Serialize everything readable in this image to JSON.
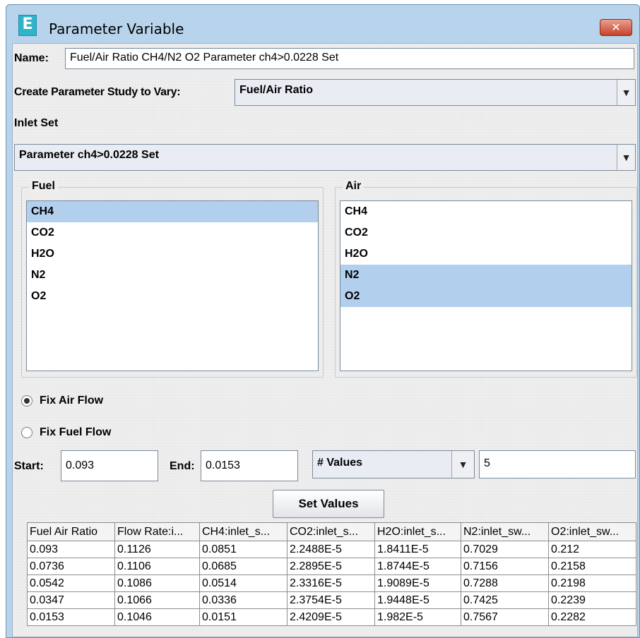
{
  "window": {
    "title": "Parameter Variable",
    "icon_letter": "E",
    "close_glyph": "✕"
  },
  "name_row": {
    "label": "Name:",
    "value": "Fuel/Air Ratio CH4/N2 O2 Parameter ch4>0.0228 Set"
  },
  "study": {
    "label": "Create Parameter Study to Vary:",
    "selected": "Fuel/Air Ratio"
  },
  "inlet": {
    "label": "Inlet Set",
    "selected": "Parameter ch4>0.0228 Set"
  },
  "fuel": {
    "title": "Fuel",
    "items": [
      {
        "label": "CH4",
        "selected": true
      },
      {
        "label": "CO2",
        "selected": false
      },
      {
        "label": "H2O",
        "selected": false
      },
      {
        "label": "N2",
        "selected": false
      },
      {
        "label": "O2",
        "selected": false
      }
    ]
  },
  "air": {
    "title": "Air",
    "items": [
      {
        "label": "CH4",
        "selected": false
      },
      {
        "label": "CO2",
        "selected": false
      },
      {
        "label": "H2O",
        "selected": false
      },
      {
        "label": "N2",
        "selected": true
      },
      {
        "label": "O2",
        "selected": true
      }
    ]
  },
  "flow_mode": {
    "options": [
      {
        "label": "Fix Air Flow",
        "checked": true
      },
      {
        "label": "Fix Fuel Flow",
        "checked": false
      }
    ]
  },
  "range": {
    "start_label": "Start:",
    "start_value": "0.093",
    "end_label": "End:",
    "end_value": "0.0153",
    "count_mode": "# Values",
    "count_value": "5"
  },
  "set_values_label": "Set Values",
  "table": {
    "headers": [
      "Fuel Air Ratio",
      "Flow Rate:i...",
      "CH4:inlet_s...",
      "CO2:inlet_s...",
      "H2O:inlet_s...",
      "N2:inlet_sw...",
      "O2:inlet_sw..."
    ],
    "rows": [
      [
        "0.093",
        "0.1126",
        "0.0851",
        "2.2488E-5",
        "1.8411E-5",
        "0.7029",
        "0.212"
      ],
      [
        "0.0736",
        "0.1106",
        "0.0685",
        "2.2895E-5",
        "1.8744E-5",
        "0.7156",
        "0.2158"
      ],
      [
        "0.0542",
        "0.1086",
        "0.0514",
        "2.3316E-5",
        "1.9089E-5",
        "0.7288",
        "0.2198"
      ],
      [
        "0.0347",
        "0.1066",
        "0.0336",
        "2.3754E-5",
        "1.9448E-5",
        "0.7425",
        "0.2239"
      ],
      [
        "0.0153",
        "0.1046",
        "0.0151",
        "2.4209E-5",
        "1.982E-5",
        "0.7567",
        "0.2282"
      ]
    ]
  }
}
